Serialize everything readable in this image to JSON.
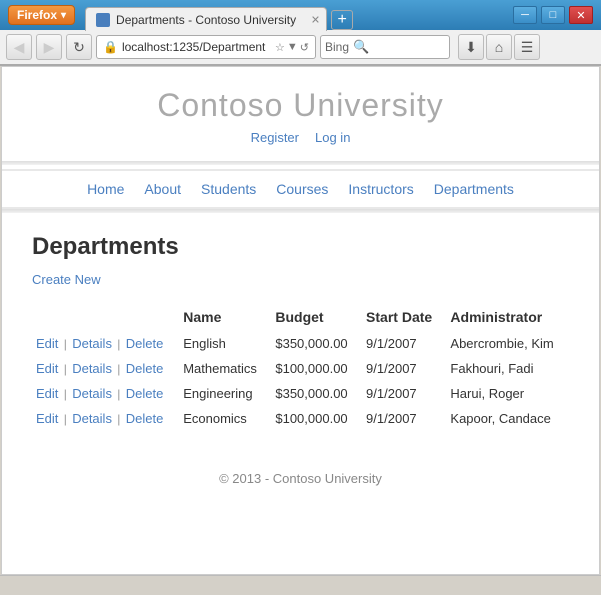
{
  "titlebar": {
    "firefox_label": "Firefox",
    "tab_title": "Departments - Contoso University",
    "new_tab_label": "+",
    "minimize": "─",
    "restore": "□",
    "close": "✕"
  },
  "navbar": {
    "back_arrow": "◀",
    "forward_arrow": "▶",
    "refresh": "↻",
    "address": "localhost:1235/Department",
    "search_placeholder": "Bing",
    "download": "⬇",
    "home": "⌂"
  },
  "page": {
    "site_title": "Contoso University",
    "register_link": "Register",
    "login_link": "Log in",
    "nav_items": [
      "Home",
      "About",
      "Students",
      "Courses",
      "Instructors",
      "Departments"
    ],
    "page_heading": "Departments",
    "create_new_label": "Create New",
    "table": {
      "headers": [
        "Name",
        "Budget",
        "Start Date",
        "Administrator"
      ],
      "rows": [
        {
          "name": "English",
          "budget": "$350,000.00",
          "start_date": "9/1/2007",
          "admin": "Abercrombie, Kim"
        },
        {
          "name": "Mathematics",
          "budget": "$100,000.00",
          "start_date": "9/1/2007",
          "admin": "Fakhouri, Fadi"
        },
        {
          "name": "Engineering",
          "budget": "$350,000.00",
          "start_date": "9/1/2007",
          "admin": "Harui, Roger"
        },
        {
          "name": "Economics",
          "budget": "$100,000.00",
          "start_date": "9/1/2007",
          "admin": "Kapoor, Candace"
        }
      ],
      "action_edit": "Edit",
      "action_details": "Details",
      "action_delete": "Delete"
    },
    "footer_text": "© 2013 - Contoso University"
  }
}
